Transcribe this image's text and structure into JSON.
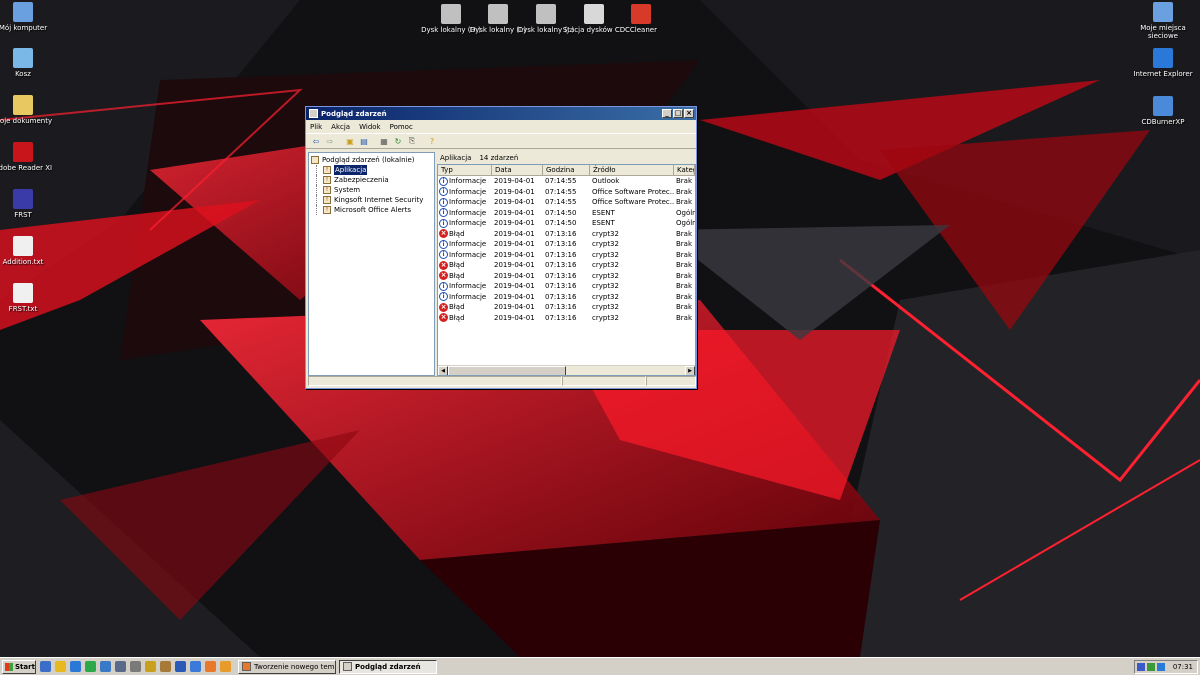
{
  "desktop": {
    "left_icons": [
      {
        "label": "Mój komputer",
        "icon": "computer-icon",
        "color": "#6aa0e0"
      },
      {
        "label": "Kosz",
        "icon": "recycle-bin-icon",
        "color": "#7ab8e8"
      },
      {
        "label": "Moje dokumenty",
        "icon": "documents-folder-icon",
        "color": "#e8c860"
      },
      {
        "label": "Adobe Reader XI",
        "icon": "adobe-reader-icon",
        "color": "#c8151b"
      },
      {
        "label": "FRST",
        "icon": "frst-icon",
        "color": "#3a3aa8"
      },
      {
        "label": "Addition.txt",
        "icon": "text-file-icon",
        "color": "#f0f0f0"
      },
      {
        "label": "FRST.txt",
        "icon": "text-file-icon",
        "color": "#f0f0f0"
      }
    ],
    "top_icons": [
      {
        "label": "Dysk lokalny (H:)",
        "icon": "hard-drive-icon",
        "color": "#c0c0c0"
      },
      {
        "label": "Dysk lokalny (I:)",
        "icon": "hard-drive-icon",
        "color": "#c0c0c0"
      },
      {
        "label": "Dysk lokalny (J:)",
        "icon": "hard-drive-icon",
        "color": "#c0c0c0"
      },
      {
        "label": "Stacja dysków CD",
        "icon": "cd-drive-icon",
        "color": "#d8d8d8"
      },
      {
        "label": "CCleaner",
        "icon": "ccleaner-icon",
        "color": "#d83a2a"
      }
    ],
    "right_icons": [
      {
        "label": "Moje miejsca sieciowe",
        "icon": "network-places-icon",
        "color": "#6aa0e0"
      },
      {
        "label": "Internet Explorer",
        "icon": "internet-explorer-icon",
        "color": "#2a78d8"
      },
      {
        "label": "CDBurnerXP",
        "icon": "cdburner-icon",
        "color": "#4a8ad8"
      }
    ]
  },
  "window": {
    "title": "Podgląd zdarzeń",
    "menu": [
      "Plik",
      "Akcja",
      "Widok",
      "Pomoc"
    ],
    "tree": {
      "root": "Podgląd zdarzeń (lokalnie)",
      "children": [
        "Aplikacja",
        "Zabezpieczenia",
        "System",
        "Kingsoft Internet Security",
        "Microsoft Office Alerts"
      ],
      "selected_index": 0
    },
    "list_header": {
      "name": "Aplikacja",
      "count": "14 zdarzeń"
    },
    "columns": [
      "Typ",
      "Data",
      "Godzina",
      "Źródło",
      "Kategoria"
    ],
    "events": [
      {
        "severity": "info",
        "type": "Informacje",
        "date": "2019-04-01",
        "time": "07:14:55",
        "source": "Outlook",
        "category": "Brak"
      },
      {
        "severity": "info",
        "type": "Informacje",
        "date": "2019-04-01",
        "time": "07:14:55",
        "source": "Office Software Protec...",
        "category": "Brak"
      },
      {
        "severity": "info",
        "type": "Informacje",
        "date": "2019-04-01",
        "time": "07:14:55",
        "source": "Office Software Protec...",
        "category": "Brak"
      },
      {
        "severity": "info",
        "type": "Informacje",
        "date": "2019-04-01",
        "time": "07:14:50",
        "source": "ESENT",
        "category": "Ogólne"
      },
      {
        "severity": "info",
        "type": "Informacje",
        "date": "2019-04-01",
        "time": "07:14:50",
        "source": "ESENT",
        "category": "Ogólne"
      },
      {
        "severity": "error",
        "type": "Błąd",
        "date": "2019-04-01",
        "time": "07:13:16",
        "source": "crypt32",
        "category": "Brak"
      },
      {
        "severity": "info",
        "type": "Informacje",
        "date": "2019-04-01",
        "time": "07:13:16",
        "source": "crypt32",
        "category": "Brak"
      },
      {
        "severity": "info",
        "type": "Informacje",
        "date": "2019-04-01",
        "time": "07:13:16",
        "source": "crypt32",
        "category": "Brak"
      },
      {
        "severity": "error",
        "type": "Błąd",
        "date": "2019-04-01",
        "time": "07:13:16",
        "source": "crypt32",
        "category": "Brak"
      },
      {
        "severity": "error",
        "type": "Błąd",
        "date": "2019-04-01",
        "time": "07:13:16",
        "source": "crypt32",
        "category": "Brak"
      },
      {
        "severity": "info",
        "type": "Informacje",
        "date": "2019-04-01",
        "time": "07:13:16",
        "source": "crypt32",
        "category": "Brak"
      },
      {
        "severity": "info",
        "type": "Informacje",
        "date": "2019-04-01",
        "time": "07:13:16",
        "source": "crypt32",
        "category": "Brak"
      },
      {
        "severity": "error",
        "type": "Błąd",
        "date": "2019-04-01",
        "time": "07:13:16",
        "source": "crypt32",
        "category": "Brak"
      },
      {
        "severity": "error",
        "type": "Błąd",
        "date": "2019-04-01",
        "time": "07:13:16",
        "source": "crypt32",
        "category": "Brak"
      }
    ]
  },
  "taskbar": {
    "start_label": "Start",
    "quicklaunch": [
      {
        "icon": "show-desktop-icon",
        "color": "#3a6ec8"
      },
      {
        "icon": "chrome-icon",
        "color": "#e8b820"
      },
      {
        "icon": "internet-explorer-icon",
        "color": "#2a78d8"
      },
      {
        "icon": "ccleaner-icon",
        "color": "#2aa84a"
      },
      {
        "icon": "checkmark-icon",
        "color": "#3a78c8"
      },
      {
        "icon": "wireless-icon",
        "color": "#5a6a8a"
      },
      {
        "icon": "tools-icon",
        "color": "#7a7a7a"
      },
      {
        "icon": "kingsoft-icon",
        "color": "#c8a020"
      },
      {
        "icon": "winamp-icon",
        "color": "#a87a3a"
      },
      {
        "icon": "word-icon",
        "color": "#2a5ab8"
      },
      {
        "icon": "outlook-icon",
        "color": "#3a7ad8"
      },
      {
        "icon": "firefox-icon",
        "color": "#e8782a"
      },
      {
        "icon": "fox-icon",
        "color": "#e89a2a"
      }
    ],
    "tasks": [
      {
        "label": "Tworzenie nowego tema...",
        "active": false
      },
      {
        "label": "Podgląd zdarzeń",
        "active": true
      }
    ],
    "clock": "07:31"
  }
}
